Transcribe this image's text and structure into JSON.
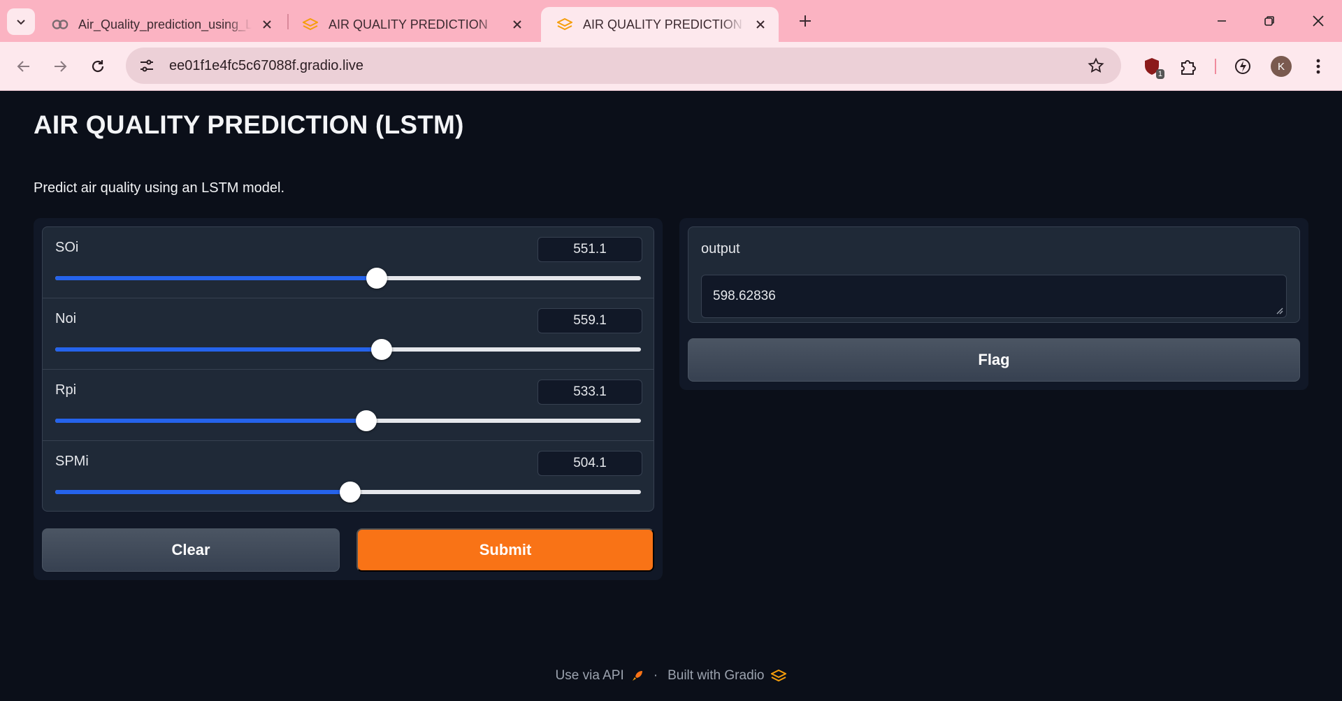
{
  "browser": {
    "tabs": [
      {
        "title": "Air_Quality_prediction_using_Lstm.ipynb - Colab",
        "favicon": "colab-icon",
        "active": false
      },
      {
        "title": "AIR QUALITY PREDICTION",
        "favicon": "gradio-icon",
        "active": false
      },
      {
        "title": "AIR QUALITY PREDICTION (LSTM)",
        "favicon": "gradio-icon",
        "active": true
      }
    ],
    "url": "ee01f1e4fc5c67088f.gradio.live",
    "extension_badge": "1",
    "avatar_initial": "K"
  },
  "app": {
    "title": "AIR QUALITY PREDICTION (LSTM)",
    "description": "Predict air quality using an LSTM model.",
    "sliders": [
      {
        "label": "SOi",
        "value": "551.1",
        "fraction": 0.549
      },
      {
        "label": "Noi",
        "value": "559.1",
        "fraction": 0.557
      },
      {
        "label": "Rpi",
        "value": "533.1",
        "fraction": 0.531
      },
      {
        "label": "SPMi",
        "value": "504.1",
        "fraction": 0.503
      }
    ],
    "clear_label": "Clear",
    "submit_label": "Submit",
    "output_label": "output",
    "output_value": "598.62836",
    "flag_label": "Flag"
  },
  "footer": {
    "api_link": "Use via API",
    "separator": "·",
    "built_with": "Built with Gradio"
  },
  "colors": {
    "accent": "#f97316",
    "slider_fill": "#2563eb",
    "background": "#0b0f19",
    "chrome": "#fbb3c2"
  }
}
